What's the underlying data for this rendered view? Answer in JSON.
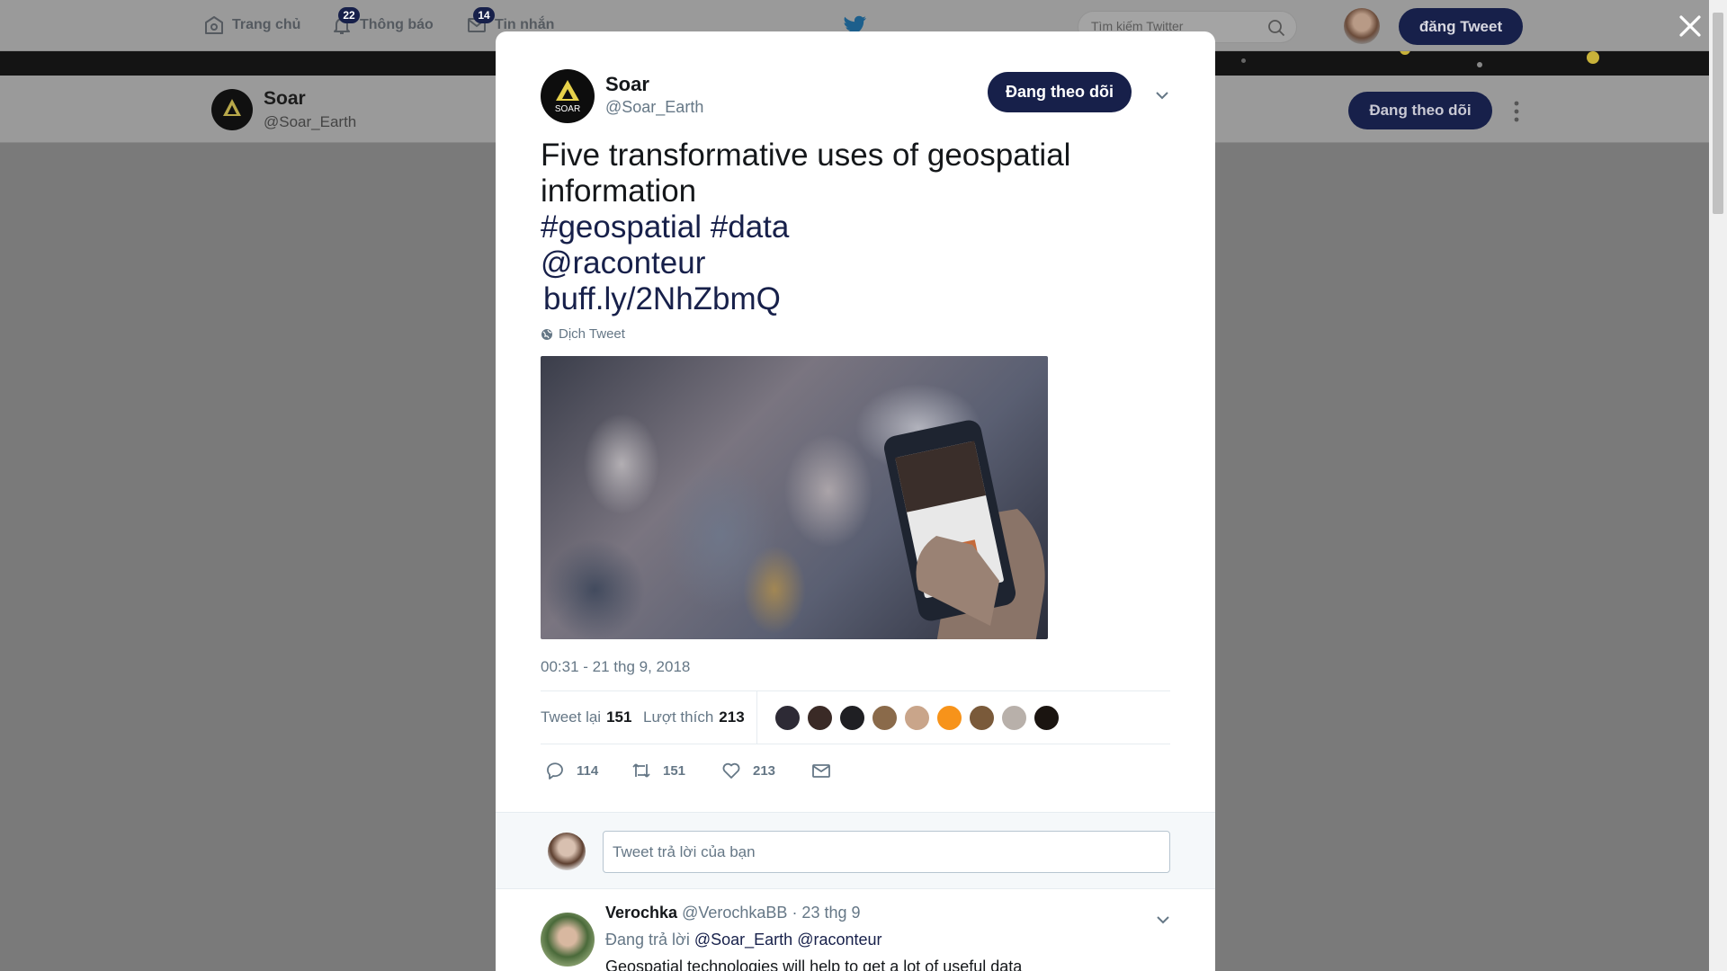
{
  "topnav": {
    "home_label": "Trang chủ",
    "notifications_label": "Thông báo",
    "notifications_count": "22",
    "messages_label": "Tin nhắn",
    "messages_count": "14",
    "search_placeholder": "Tìm kiếm Twitter",
    "tweet_button": "đăng Tweet"
  },
  "profile_bar": {
    "name": "Soar",
    "handle": "@Soar_Earth",
    "follow_button": "Đang theo dõi"
  },
  "tweet": {
    "author_name": "Soar",
    "author_handle": "@Soar_Earth",
    "follow_button": "Đang theo dõi",
    "text_line1": "Five transformative uses of geospatial",
    "text_line2": "information",
    "hashtags": "#geospatial #data",
    "mention": "@raconteur",
    "link": "buff.ly/2NhZbmQ",
    "translate_label": "Dịch Tweet",
    "timestamp": "00:31 - 21 thg 9, 2018",
    "retweets_label": "Tweet lại",
    "retweets_count": "151",
    "likes_label": "Lượt thích",
    "likes_count": "213",
    "reply_count": "114",
    "retweet_action_count": "151",
    "like_action_count": "213"
  },
  "reply_composer": {
    "placeholder": "Tweet trả lời của bạn"
  },
  "reply": {
    "name": "Verochka",
    "handle": "@VerochkaBB",
    "time": "· 23 thg 9",
    "replying_to_label": "Đang trả lời",
    "mention1": "@Soar_Earth",
    "mention2": "@raconteur",
    "text": "Geospatial technologies will help to get a lot of useful data"
  },
  "colors": {
    "accent": "#17204a",
    "secondary_text": "#657786",
    "overlay": "#7a7a7a"
  },
  "likers": [
    "#2d2a35",
    "#3a2a26",
    "#1f1f23",
    "#8a6a4a",
    "#c9a58a",
    "#f7931a",
    "#7a5a3a",
    "#b8b0aa",
    "#1a1410"
  ]
}
